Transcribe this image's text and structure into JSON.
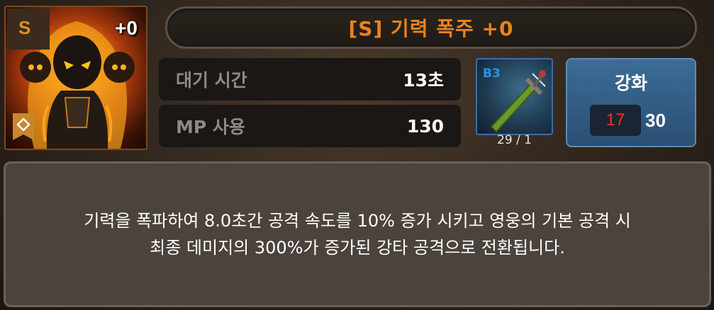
{
  "skill": {
    "grade": "S",
    "level": "+0",
    "name": "[S] 기력 폭주 +0",
    "icon": "flaming-shadow-warrior-portrait",
    "accent_color": "#e8841c"
  },
  "stats": [
    {
      "label": "대기 시간",
      "value": "13초"
    },
    {
      "label": "MP 사용",
      "value": "130"
    }
  ],
  "material": {
    "icon": "green-sword-item",
    "grade": "B3",
    "count": "29 / 1",
    "grade_color": "#2e93e8"
  },
  "enhance": {
    "label": "강화",
    "current": "17",
    "max": "30",
    "current_color": "#ff2a2a"
  },
  "description": [
    "기력을 폭파하여 8.0초간 공격 속도를 10% 증가 시키고 영웅의 기본 공격 시",
    "최종 데미지의 300%가 증가된 강타 공격으로 전환됩니다."
  ]
}
